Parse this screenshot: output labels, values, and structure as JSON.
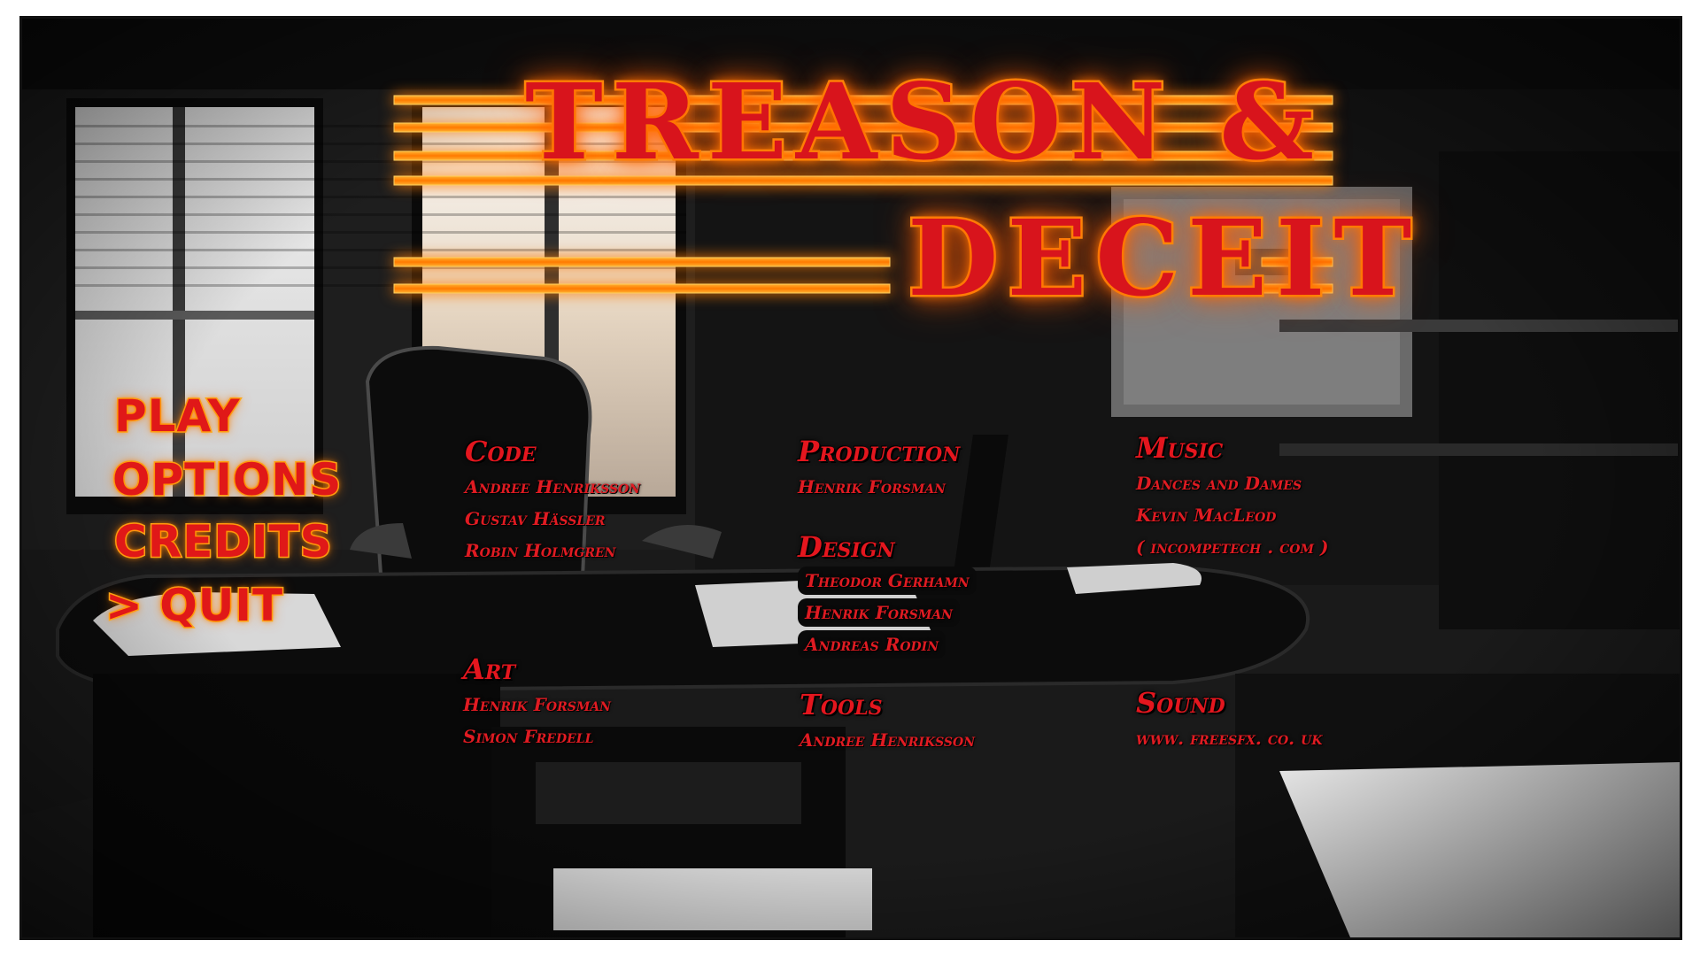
{
  "title": {
    "line1": "TREASON &",
    "line2": "DECEIT"
  },
  "menu": {
    "items": [
      {
        "label": "PLAY"
      },
      {
        "label": "OPTIONS"
      },
      {
        "label": "CREDITS"
      },
      {
        "label": "> QUIT",
        "selected": true
      }
    ]
  },
  "credits": {
    "code": {
      "heading": "Code",
      "names": [
        "Andree Henriksson",
        "Gustav Hässler",
        "Robin Holmgren"
      ]
    },
    "art": {
      "heading": "Art",
      "names": [
        "Henrik Forsman",
        "Simon Fredell"
      ]
    },
    "production": {
      "heading": "Production",
      "names": [
        "Henrik Forsman"
      ]
    },
    "design": {
      "heading": "Design",
      "names": [
        "Theodor Gerhamn",
        "Henrik Forsman",
        "Andreas Rodin"
      ]
    },
    "tools": {
      "heading": "Tools",
      "names": [
        "Andree Henriksson"
      ]
    },
    "music": {
      "heading": "Music",
      "names": [
        "Dances and Dames",
        "Kevin MacLeod",
        "( incompetech . com )"
      ]
    },
    "sound": {
      "heading": "Sound",
      "names": [
        "www. freesfx. co. uk"
      ]
    }
  },
  "colors": {
    "neon_red": "#d8141c",
    "neon_orange": "#ff9a10",
    "credit_red": "#e01b22"
  }
}
